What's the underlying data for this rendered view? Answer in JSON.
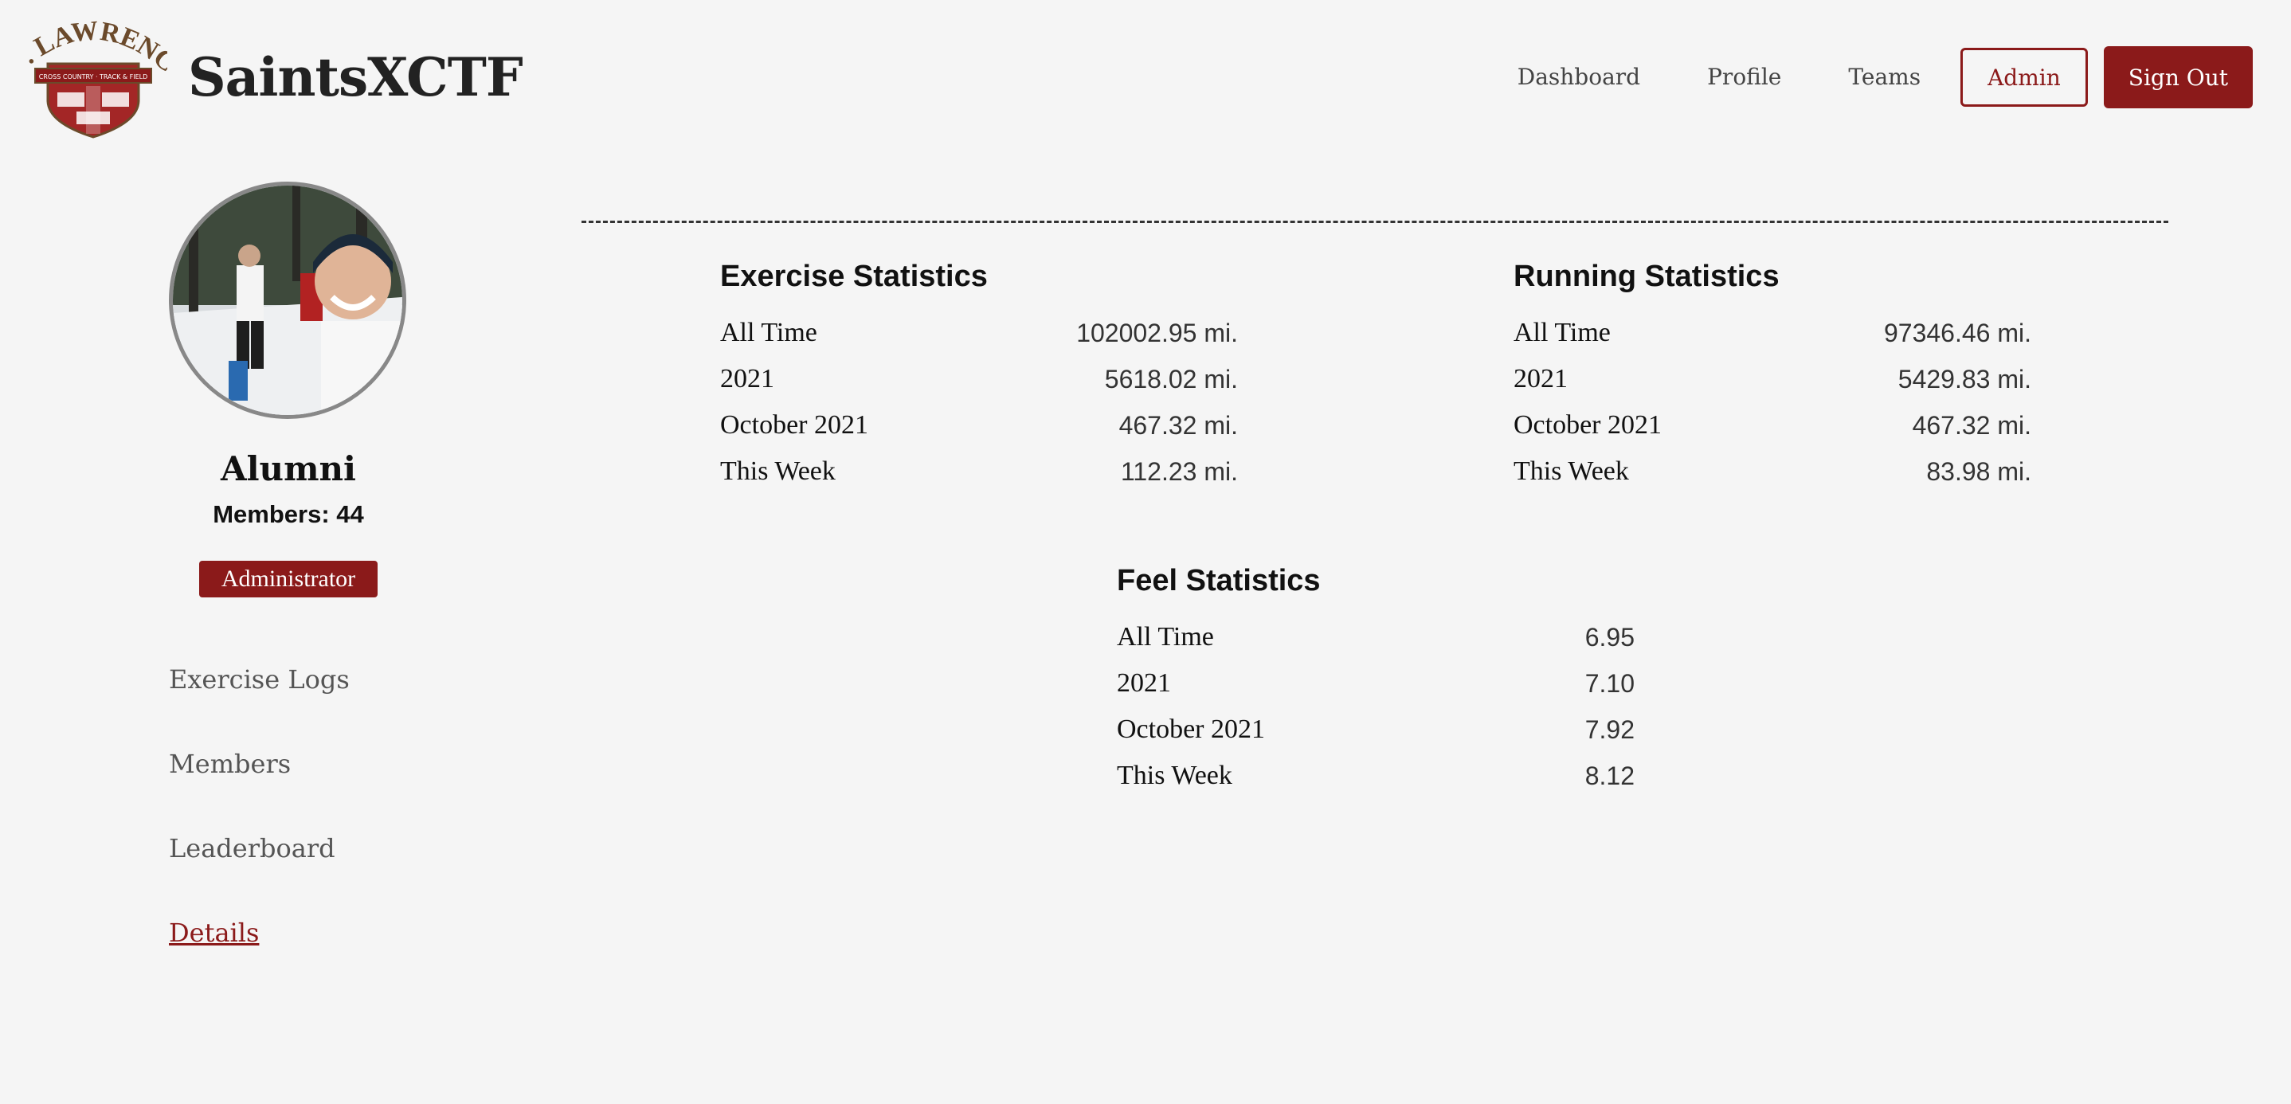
{
  "header": {
    "logo_text": "ST. LAWRENCE",
    "logo_subtext": "CROSS COUNTRY · TRACK & FIELD",
    "brand": "SaintsXCTF",
    "nav": {
      "dashboard": "Dashboard",
      "profile": "Profile",
      "teams": "Teams",
      "admin": "Admin",
      "signout": "Sign Out"
    }
  },
  "sidebar": {
    "group_name": "Alumni",
    "members": "Members: 44",
    "role": "Administrator",
    "items": [
      {
        "label": "Exercise Logs"
      },
      {
        "label": "Members"
      },
      {
        "label": "Leaderboard"
      },
      {
        "label": "Details"
      }
    ]
  },
  "stats": {
    "exercise": {
      "title": "Exercise Statistics",
      "rows": [
        {
          "label": "All Time",
          "value": "102002.95 mi."
        },
        {
          "label": "2021",
          "value": "5618.02 mi."
        },
        {
          "label": "October 2021",
          "value": "467.32 mi."
        },
        {
          "label": "This Week",
          "value": "112.23 mi."
        }
      ]
    },
    "running": {
      "title": "Running Statistics",
      "rows": [
        {
          "label": "All Time",
          "value": "97346.46 mi."
        },
        {
          "label": "2021",
          "value": "5429.83 mi."
        },
        {
          "label": "October 2021",
          "value": "467.32 mi."
        },
        {
          "label": "This Week",
          "value": "83.98 mi."
        }
      ]
    },
    "feel": {
      "title": "Feel Statistics",
      "rows": [
        {
          "label": "All Time",
          "value": "6.95"
        },
        {
          "label": "2021",
          "value": "7.10"
        },
        {
          "label": "October 2021",
          "value": "7.92"
        },
        {
          "label": "This Week",
          "value": "8.12"
        }
      ]
    }
  },
  "colors": {
    "accent": "#8b1a1a",
    "background": "#f5f5f5"
  }
}
